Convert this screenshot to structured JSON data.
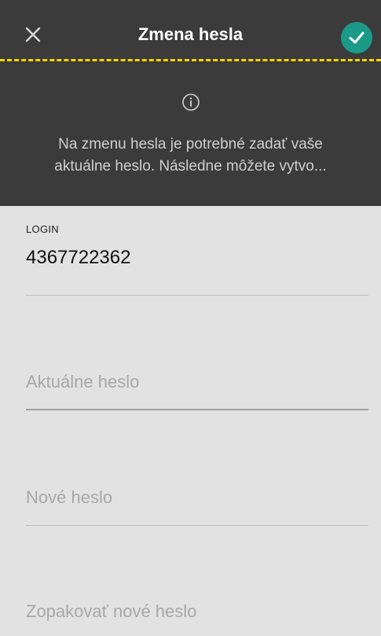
{
  "header": {
    "title": "Zmena hesla",
    "close_icon": "close-icon",
    "confirm_icon": "checkmark-icon",
    "confirm_color": "#1a9a87",
    "dash_color": "#f2d600"
  },
  "info": {
    "icon": "info-icon",
    "line1": "Na zmenu hesla je potrebné zadať vaše",
    "line2": "aktuálne heslo. Následne môžete vytvo..."
  },
  "form": {
    "login": {
      "label": "LOGIN",
      "value": "4367722362"
    },
    "current_password": {
      "placeholder": "Aktuálne heslo"
    },
    "new_password": {
      "placeholder": "Nové heslo"
    },
    "repeat_password": {
      "placeholder": "Zopakovať nové heslo"
    }
  }
}
